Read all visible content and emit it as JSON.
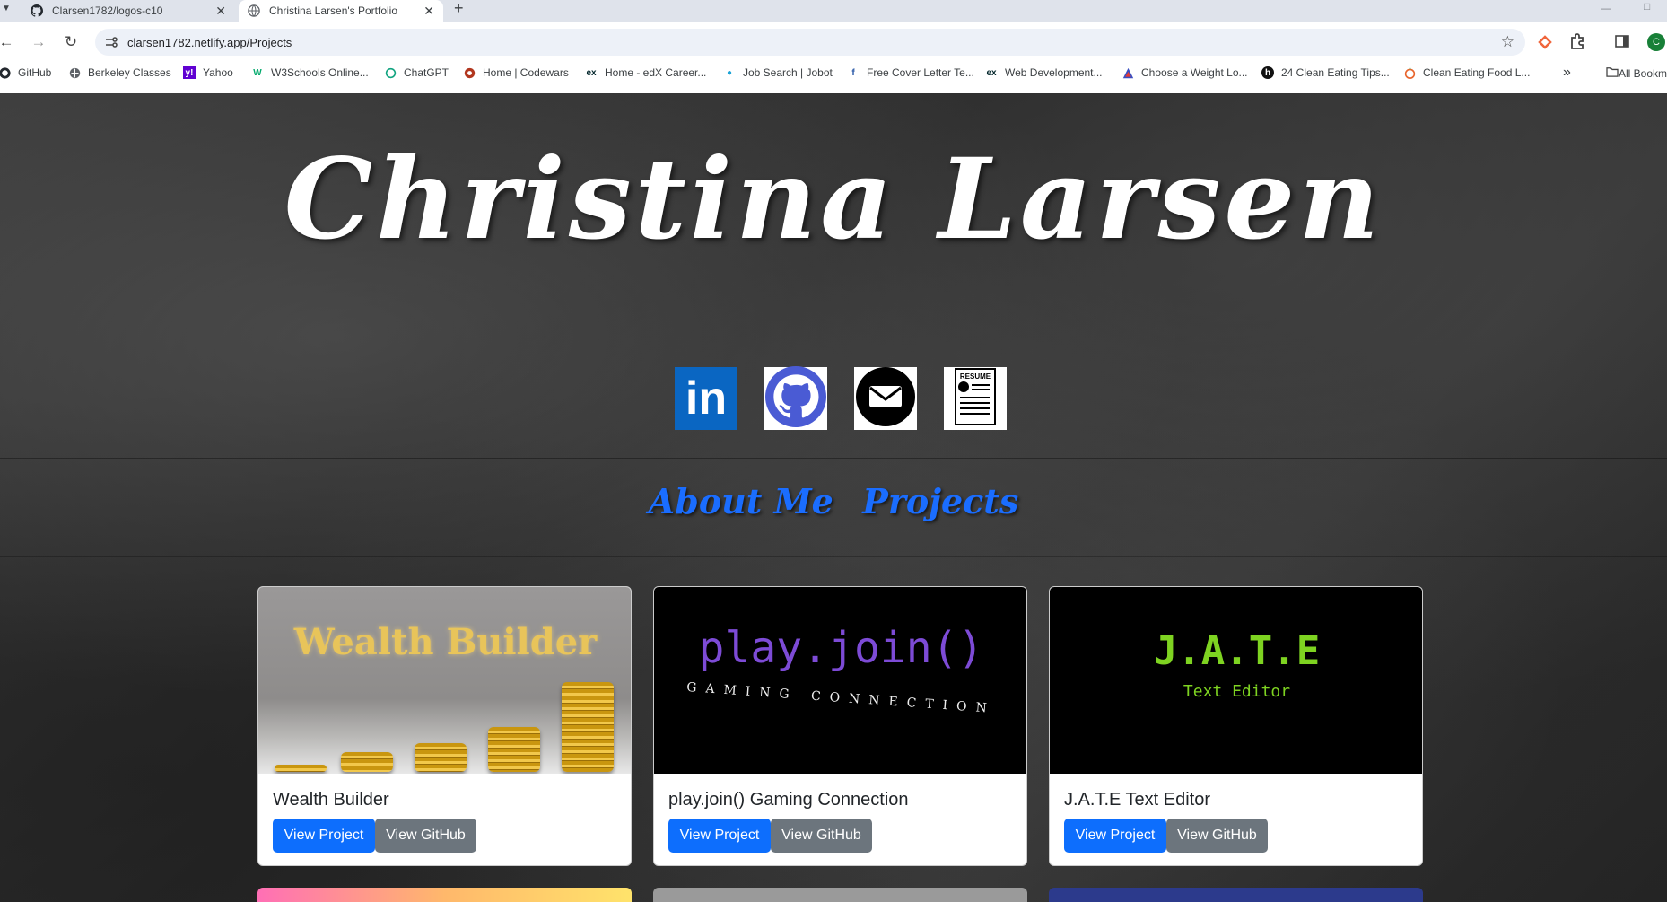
{
  "browser": {
    "tabs": [
      {
        "title": "Clarsen1782/logos-c10",
        "icon": "github-icon"
      },
      {
        "title": "Christina Larsen's Portfolio",
        "icon": "globe-icon",
        "active": true
      }
    ],
    "url": "clarsen1782.netlify.app/Projects",
    "profile_initial": "C",
    "bookmarks": [
      {
        "label": "GitHub",
        "icon": "github-icon"
      },
      {
        "label": "Berkeley Classes",
        "icon": "globe-icon"
      },
      {
        "label": "Yahoo",
        "icon": "yahoo-icon"
      },
      {
        "label": "W3Schools Online...",
        "icon": "w3schools-icon"
      },
      {
        "label": "ChatGPT",
        "icon": "chatgpt-icon"
      },
      {
        "label": "Home | Codewars",
        "icon": "codewars-icon"
      },
      {
        "label": "Home - edX Career...",
        "icon": "edx-icon"
      },
      {
        "label": "Job Search | Jobot",
        "icon": "jobot-icon"
      },
      {
        "label": "Free Cover Letter Te...",
        "icon": "cover-letter-icon"
      },
      {
        "label": "Web Development...",
        "icon": "edx-icon"
      },
      {
        "label": "Choose a Weight Lo...",
        "icon": "triangle-icon"
      },
      {
        "label": "24 Clean Eating Tips...",
        "icon": "h-icon"
      },
      {
        "label": "Clean Eating Food L...",
        "icon": "food-icon"
      }
    ],
    "all_bookmarks": "All Bookmarks"
  },
  "hero": {
    "name": "Christina Larsen"
  },
  "socials": [
    {
      "name": "linkedin",
      "label": "in"
    },
    {
      "name": "github"
    },
    {
      "name": "email"
    },
    {
      "name": "resume",
      "label": "RESUME"
    }
  ],
  "nav": {
    "about": "About Me",
    "projects": "Projects"
  },
  "projects": [
    {
      "title": "Wealth Builder",
      "thumb_text": "Wealth Builder",
      "view_project": "View Project",
      "view_github": "View GitHub"
    },
    {
      "title": "play.join() Gaming Connection",
      "thumb_text": "play.join()",
      "thumb_sub": "GAMING CONNECTION",
      "view_project": "View Project",
      "view_github": "View GitHub"
    },
    {
      "title": "J.A.T.E Text Editor",
      "thumb_text": "J.A.T.E",
      "thumb_sub": "Text Editor",
      "view_project": "View Project",
      "view_github": "View GitHub"
    }
  ],
  "colors": {
    "primary_button": "#0d6efd",
    "secondary_button": "#6c757d",
    "nav_link": "#1a6dff"
  }
}
